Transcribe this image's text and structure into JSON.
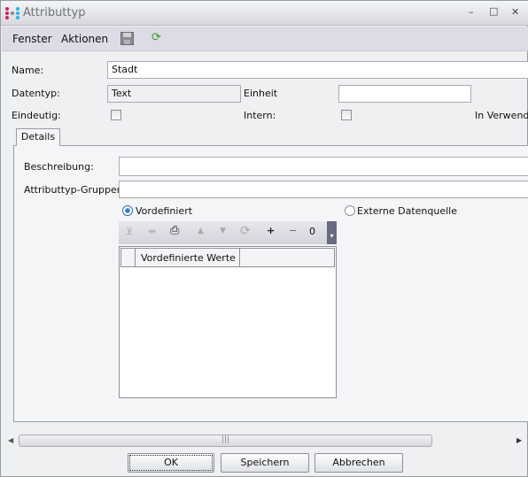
{
  "window": {
    "title": "Attributtyp",
    "controls": [
      "–",
      "□",
      "✕"
    ]
  },
  "menu": {
    "items": [
      "Fenster",
      "Aktionen"
    ]
  },
  "form": {
    "name_label": "Name:",
    "name_value": "Stadt",
    "datentyp_label": "Datentyp:",
    "datentyp_value": "Text",
    "einheit_label": "Einheit",
    "einheit_value": "",
    "eindeutig_label": "Eindeutig:",
    "eindeutig_checked": false,
    "intern_label": "Intern:",
    "intern_checked": false,
    "in_verwendung_label": "In Verwendu"
  },
  "tabs": [
    {
      "label": "Details",
      "active": true
    }
  ],
  "details": {
    "beschreibung_label": "Beschreibung:",
    "beschreibung_value": "",
    "gruppen_label": "Attributtyp-Gruppen:",
    "gruppen_value": "",
    "radio_vordefiniert": "Vordefiniert",
    "radio_extern": "Externe Datenquelle",
    "selected": "Vordefiniert",
    "grid_toolbar": {
      "plus": "+",
      "minus": "−",
      "count": "0"
    },
    "grid_columns": [
      "Vordefinierte Werte"
    ]
  },
  "buttons": {
    "ok": "OK",
    "save": "Speichern",
    "cancel": "Abbrechen"
  }
}
